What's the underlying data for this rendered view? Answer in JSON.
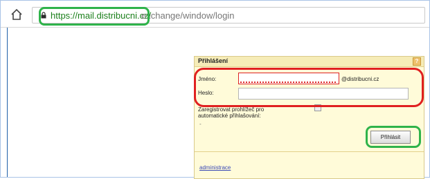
{
  "browser": {
    "url_secure_part": "https://mail.distribucni.cz/",
    "url_rest_part": "exchange/window/login",
    "icons": {
      "home": "home-icon",
      "lock": "lock-icon"
    }
  },
  "login": {
    "title": "Přihlášení",
    "help_label": "?",
    "username_label": "Jméno:",
    "username_value": "",
    "domain_suffix": "@distribucni.cz",
    "password_label": "Heslo:",
    "password_value": "",
    "remember_label_line1": "Zaregistrovat prohlížeč pro",
    "remember_label_line2": "automatické přihlašování:",
    "remember_checked": false,
    "dash": "-",
    "submit_label": "Přihlásit",
    "admin_link": "administrace"
  },
  "colors": {
    "highlight_green": "#2fb34a",
    "highlight_red": "#e02020",
    "panel_bg": "#fffbd9",
    "panel_header": "#f6ecb7",
    "secure_url": "#1a7f1a",
    "link": "#3a49b5"
  }
}
